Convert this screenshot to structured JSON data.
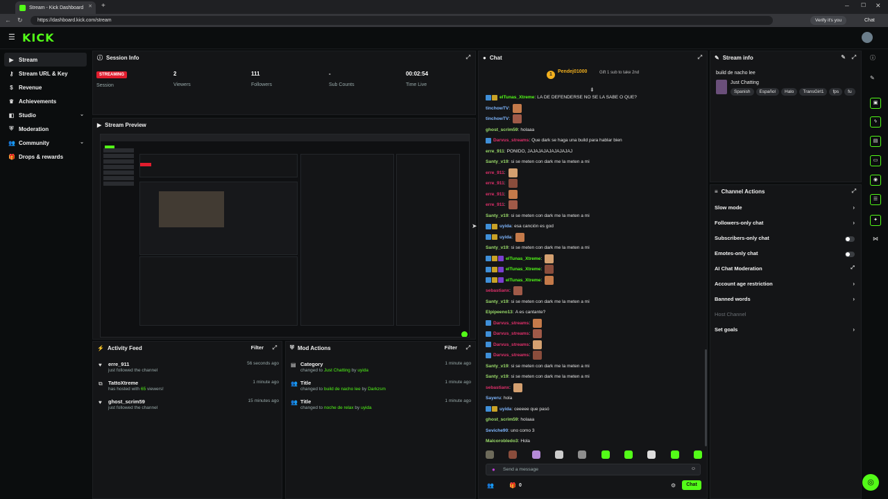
{
  "browser": {
    "tab_title": "Stream - Kick Dashboard",
    "url": "https://dashboard.kick.com/stream",
    "profile_label": "Verify it's you",
    "chat_label": "Chat"
  },
  "app": {
    "logo": "KICK"
  },
  "sidebar": {
    "items": [
      {
        "label": "Stream",
        "icon": "video-icon",
        "active": true
      },
      {
        "label": "Stream URL & Key",
        "icon": "key-icon"
      },
      {
        "label": "Revenue",
        "icon": "dollar-icon"
      },
      {
        "label": "Achievements",
        "icon": "trophy-icon"
      },
      {
        "label": "Studio",
        "icon": "studio-icon",
        "chevron": true
      },
      {
        "label": "Moderation",
        "icon": "shield-icon"
      },
      {
        "label": "Community",
        "icon": "people-icon",
        "chevron": true
      },
      {
        "label": "Drops & rewards",
        "icon": "gift-icon"
      }
    ]
  },
  "session": {
    "title": "Session Info",
    "status_badge": "STREAMING",
    "status_label": "Session",
    "stats": [
      {
        "value": "2",
        "label": "Viewers"
      },
      {
        "value": "111",
        "label": "Followers"
      },
      {
        "value": "-",
        "label": "Sub Counts"
      },
      {
        "value": "00:02:54",
        "label": "Time Live"
      }
    ]
  },
  "preview": {
    "title": "Stream Preview"
  },
  "activity": {
    "title": "Activity Feed",
    "filter_label": "Filter",
    "items": [
      {
        "name": "erre_911",
        "sub": "just followed the channel",
        "time": "56 seconds ago"
      },
      {
        "name": "TattoXtreme",
        "sub_prefix": "has hosted with ",
        "sub_count": "65",
        "sub_suffix": " viewers!",
        "time": "1 minute ago"
      },
      {
        "name": "ghost_scrim59",
        "sub": "just followed the channel",
        "time": "15 minutes ago"
      }
    ]
  },
  "mod_actions": {
    "title": "Mod Actions",
    "filter_label": "Filter",
    "items": [
      {
        "name": "Category",
        "prefix": "changed to ",
        "value": "Just Chatting",
        "by": " by ",
        "user": "uyida",
        "time": "1 minute ago"
      },
      {
        "name": "Title",
        "prefix": "changed to ",
        "value": "build de nacho lee",
        "by": " by ",
        "user": "Darkzsm",
        "time": "1 minute ago"
      },
      {
        "name": "Title",
        "prefix": "changed to ",
        "value": "noche de relax",
        "by": " by ",
        "user": "uyida",
        "time": "1 minute ago"
      }
    ]
  },
  "chat": {
    "title": "Chat",
    "pinned_user": "Pendej01000",
    "pinned_info": "Gift 1 sub to take 2nd",
    "pinned_count": "1",
    "messages": [
      {
        "user": "elTunas_Xtreme",
        "color": "#53fc18",
        "badges": 2,
        "text": "LA DE DEFENDERSE NO SE LA SABE O QUE?"
      },
      {
        "user": "tinchowTV",
        "color": "#7fb7ff",
        "badges": 0,
        "text": "",
        "emotes": 1
      },
      {
        "user": "tinchowTV",
        "color": "#7fb7ff",
        "badges": 0,
        "text": "",
        "emotes": 1
      },
      {
        "user": "ghost_scrim59",
        "color": "#9bdc6a",
        "badges": 0,
        "text": "holaaa"
      },
      {
        "user": "Darvus_streams",
        "color": "#e0306b",
        "badges": 1,
        "text": "Que dark se haga una build para hablar bien"
      },
      {
        "user": "erre_911",
        "color": "#9bdc6a",
        "badges": 0,
        "text": "PONIDO, JAJAJAJAJAJAJAJAJ"
      },
      {
        "user": "Santy_v19",
        "color": "#9bdc6a",
        "badges": 0,
        "text": "si se meten con dark me la meten a mi"
      },
      {
        "user": "erre_911",
        "color": "#e0306b",
        "badges": 0,
        "text": "",
        "emotes": 1
      },
      {
        "user": "erre_911",
        "color": "#e0306b",
        "badges": 0,
        "text": "",
        "emotes": 1
      },
      {
        "user": "erre_911",
        "color": "#e0306b",
        "badges": 0,
        "text": "",
        "emotes": 1
      },
      {
        "user": "erre_911",
        "color": "#e0306b",
        "badges": 0,
        "text": "",
        "emotes": 1
      },
      {
        "user": "Santy_v19",
        "color": "#9bdc6a",
        "badges": 0,
        "text": "si se meten con dark me la meten a mi"
      },
      {
        "user": "uyida",
        "color": "#7fb7ff",
        "badges": 2,
        "text": "esa canción es god"
      },
      {
        "user": "uyida",
        "color": "#7fb7ff",
        "badges": 2,
        "text": "",
        "emotes": 1
      },
      {
        "user": "Santy_v19",
        "color": "#9bdc6a",
        "badges": 0,
        "text": "si se meten con dark me la meten a mi"
      },
      {
        "user": "elTunas_Xtreme",
        "color": "#53fc18",
        "badges": 3,
        "text": "",
        "emotes": 1
      },
      {
        "user": "elTunas_Xtreme",
        "color": "#53fc18",
        "badges": 3,
        "text": "",
        "emotes": 1
      },
      {
        "user": "elTunas_Xtreme",
        "color": "#53fc18",
        "badges": 3,
        "text": "",
        "emotes": 1
      },
      {
        "user": "sebastianx",
        "color": "#e0306b",
        "badges": 0,
        "text": "",
        "emotes": 1
      },
      {
        "user": "Santy_v19",
        "color": "#9bdc6a",
        "badges": 0,
        "text": "si se meten con dark me la meten a mi"
      },
      {
        "user": "Elpipeeno13",
        "color": "#9bdc6a",
        "badges": 0,
        "text": "A es cantante?"
      },
      {
        "user": "Darvus_streams",
        "color": "#e0306b",
        "badges": 1,
        "text": "",
        "emotes": 1
      },
      {
        "user": "Darvus_streams",
        "color": "#e0306b",
        "badges": 1,
        "text": "",
        "emotes": 1
      },
      {
        "user": "Darvus_streams",
        "color": "#e0306b",
        "badges": 1,
        "text": "",
        "emotes": 1
      },
      {
        "user": "Darvus_streams",
        "color": "#e0306b",
        "badges": 1,
        "text": "",
        "emotes": 1
      },
      {
        "user": "Santy_v19",
        "color": "#9bdc6a",
        "badges": 0,
        "text": "si se meten con dark me la meten a mi"
      },
      {
        "user": "Santy_v19",
        "color": "#9bdc6a",
        "badges": 0,
        "text": "si se meten con dark me la meten a mi"
      },
      {
        "user": "sebastianx",
        "color": "#e0306b",
        "badges": 0,
        "text": "",
        "emotes": 1
      },
      {
        "user": "Sayeru",
        "color": "#7fb7ff",
        "badges": 0,
        "text": "hola"
      },
      {
        "user": "uyida",
        "color": "#7fb7ff",
        "badges": 2,
        "text": "ceeeee que pasó"
      },
      {
        "user": "ghost_scrim59",
        "color": "#9bdc6a",
        "badges": 0,
        "text": "holaaa"
      },
      {
        "user": "Seviche90",
        "color": "#7fb7ff",
        "badges": 0,
        "text": "uno como 3"
      },
      {
        "user": "Malcorobledo3",
        "color": "#9bdc6a",
        "badges": 0,
        "text": "Hola"
      }
    ],
    "input_placeholder": "Send a message",
    "viewer_count": "0",
    "send_label": "Chat"
  },
  "stream_info": {
    "title": "Stream info",
    "stream_title": "build de nacho lee",
    "category": "Just Chatting",
    "tags": [
      "Spanish",
      "Español",
      "Halo",
      "TransGirl1",
      "fps",
      "fu"
    ]
  },
  "channel_actions": {
    "title": "Channel Actions",
    "items": [
      {
        "label": "Slow mode",
        "control": "arrow"
      },
      {
        "label": "Followers-only chat",
        "control": "arrow"
      },
      {
        "label": "Subscribers-only chat",
        "control": "toggle"
      },
      {
        "label": "Emotes-only chat",
        "control": "toggle"
      },
      {
        "label": "AI Chat Moderation",
        "control": "external"
      },
      {
        "label": "Account age restriction",
        "control": "arrow"
      },
      {
        "label": "Banned words",
        "control": "arrow"
      },
      {
        "label": "Host Channel",
        "control": "none",
        "disabled": true
      },
      {
        "label": "Set goals",
        "control": "arrow"
      }
    ]
  },
  "colors": {
    "accent": "#53fc18",
    "live": "#e11d2e",
    "panel": "#141517"
  }
}
